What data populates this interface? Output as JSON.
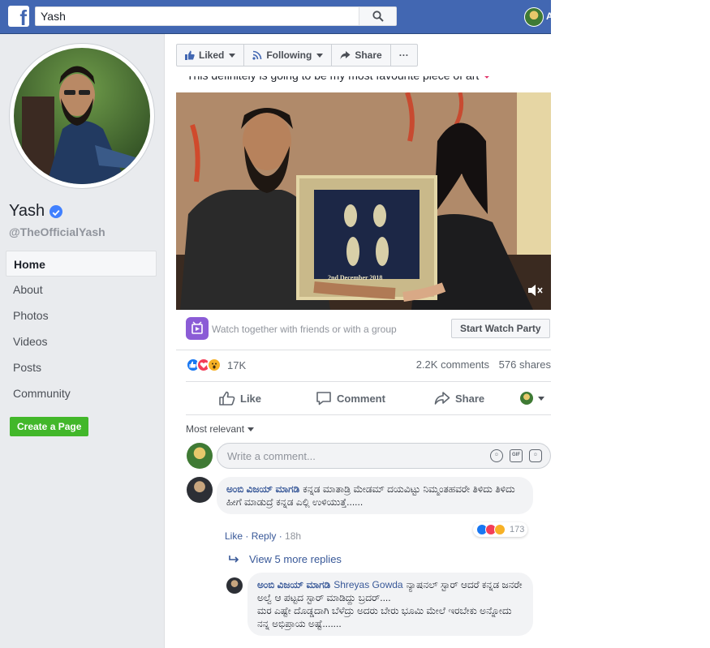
{
  "topbar": {
    "logo": "f",
    "search_value": "Yash",
    "search_icon": "search-icon",
    "brand_color": "#4267b2"
  },
  "sidebar": {
    "page_name": "Yash",
    "handle": "@TheOfficialYash",
    "nav": [
      {
        "label": "Home",
        "active": true
      },
      {
        "label": "About"
      },
      {
        "label": "Photos"
      },
      {
        "label": "Videos"
      },
      {
        "label": "Posts"
      },
      {
        "label": "Community"
      }
    ],
    "create_page_label": "Create a Page"
  },
  "post": {
    "actions": {
      "liked": "Liked",
      "following": "Following",
      "share": "Share",
      "more": "···"
    },
    "caption": "This definitely is going to be my most favourite piece of art",
    "video": {
      "frame_caption": "2nd December 2018",
      "mute_icon": "volume-mute-icon"
    },
    "watch_party": {
      "text": "Watch together with friends or with a group",
      "button": "Start Watch Party"
    },
    "reactions_count": "17K",
    "comments_count": "2.2K comments",
    "shares_count": "576 shares",
    "ufi": {
      "like": "Like",
      "comment": "Comment",
      "share": "Share"
    }
  },
  "comments_section": {
    "sort_label": "Most relevant",
    "composer_placeholder": "Write a comment...",
    "comments": [
      {
        "author": "ಅಂಬಿ ವಿಜಯ್ ಮಾಗಡಿ",
        "text": "ಕನ್ನಡ ಮಾತಾಡ್ರಿ ಮೇಡಮ್ ದಯವಿಟ್ಟು ನಿಮ್ಮಂತಹವರೇ ತಿಳಿದು ತಿಳಿದು ಹೀಗೆ ಮಾಡುದ್ರೆ ಕನ್ನಡ ಎಲ್ಲಿ ಉಳಿಯುತ್ತೆ......",
        "like": "Like",
        "reply": "Reply",
        "time": "18h",
        "reaction_count": "173"
      }
    ],
    "view_more": "View 5 more replies",
    "reply": {
      "author": "ಅಂಬಿ ವಿಜಯ್ ಮಾಗಡಿ",
      "tag": "Shreyas Gowda",
      "text_line1": "ನ್ಯಾಷನಲ್ ಸ್ಟಾರ್ ಆದರೆ ಕನ್ನಡ ಜನರೇ ಅಲ್ವೆ ಆ ಪಟ್ಟದ ಸ್ಟಾರ್ ಮಾಡಿದ್ದು ಬ್ರದರ್....",
      "text_line2": "ಮರ ಎಷ್ಟೇ ದೊಡ್ಡದಾಗಿ ಬೆಳೆದ್ರು ಅದರು ಬೇರು ಭೂಮಿ ಮೇಲೆ ಇರಬೇಕು ಅನ್ನೋದು ನನ್ನ ಅಭಿಪ್ರಾಯ ಅಷ್ಟೆ......."
    }
  }
}
